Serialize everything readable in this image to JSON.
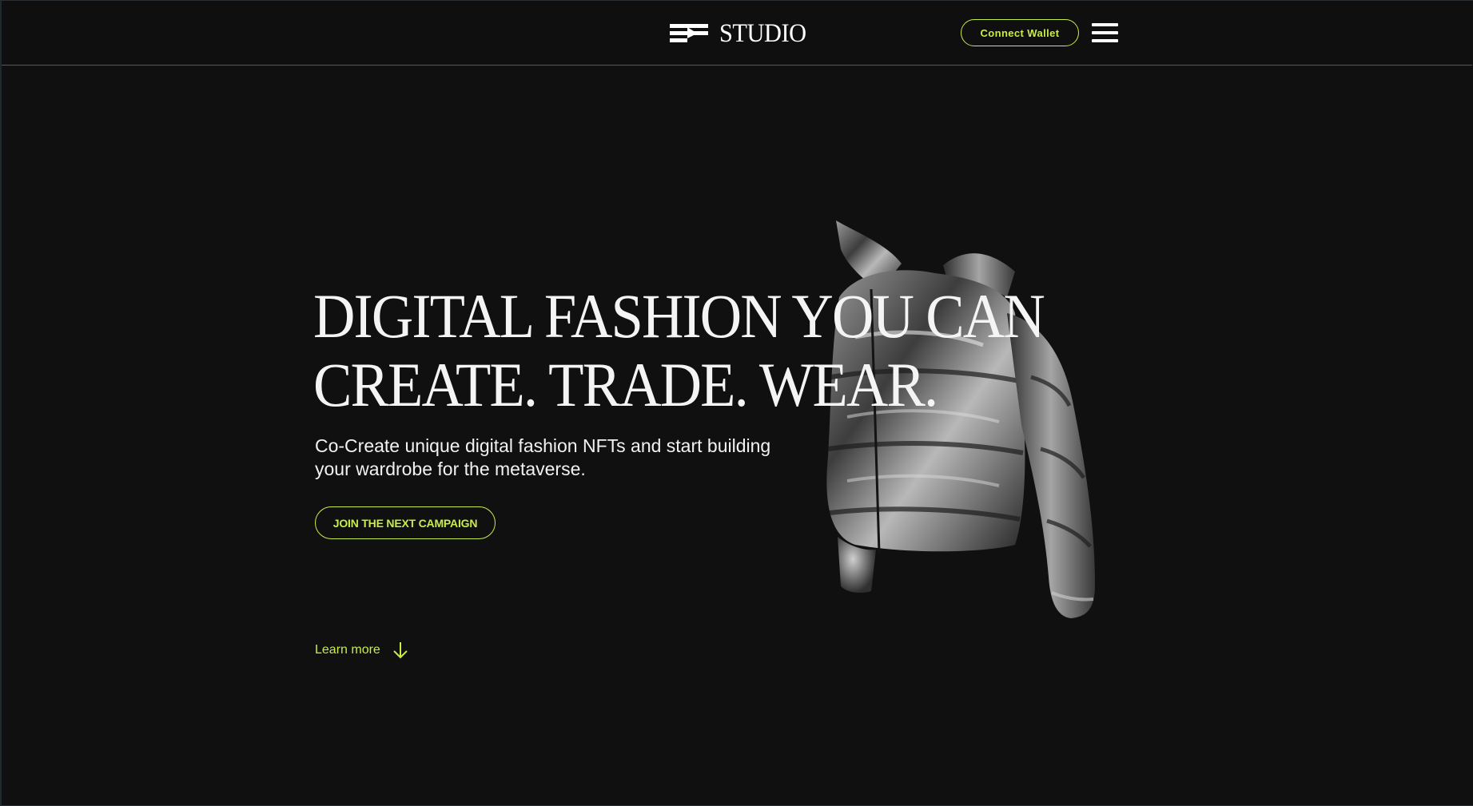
{
  "header": {
    "brand": "STUDIO",
    "connect_wallet_label": "Connect Wallet",
    "menu_icon": "hamburger-menu-icon"
  },
  "hero": {
    "headline_line1": "DIGITAL FASHION YOU CAN",
    "headline_line2": "CREATE. TRADE. WEAR.",
    "subtext_line1": "Co-Create unique digital fashion NFTs and start building",
    "subtext_line2": "your wardrobe for the metaverse.",
    "cta_label": "JOIN THE NEXT CAMPAIGN",
    "learn_more_label": "Learn more",
    "learn_more_icon": "arrow-down-icon",
    "image": "silver-puffer-jacket"
  },
  "colors": {
    "background": "#101010",
    "accent": "#c8ec4a",
    "text": "#f2f2f2"
  }
}
